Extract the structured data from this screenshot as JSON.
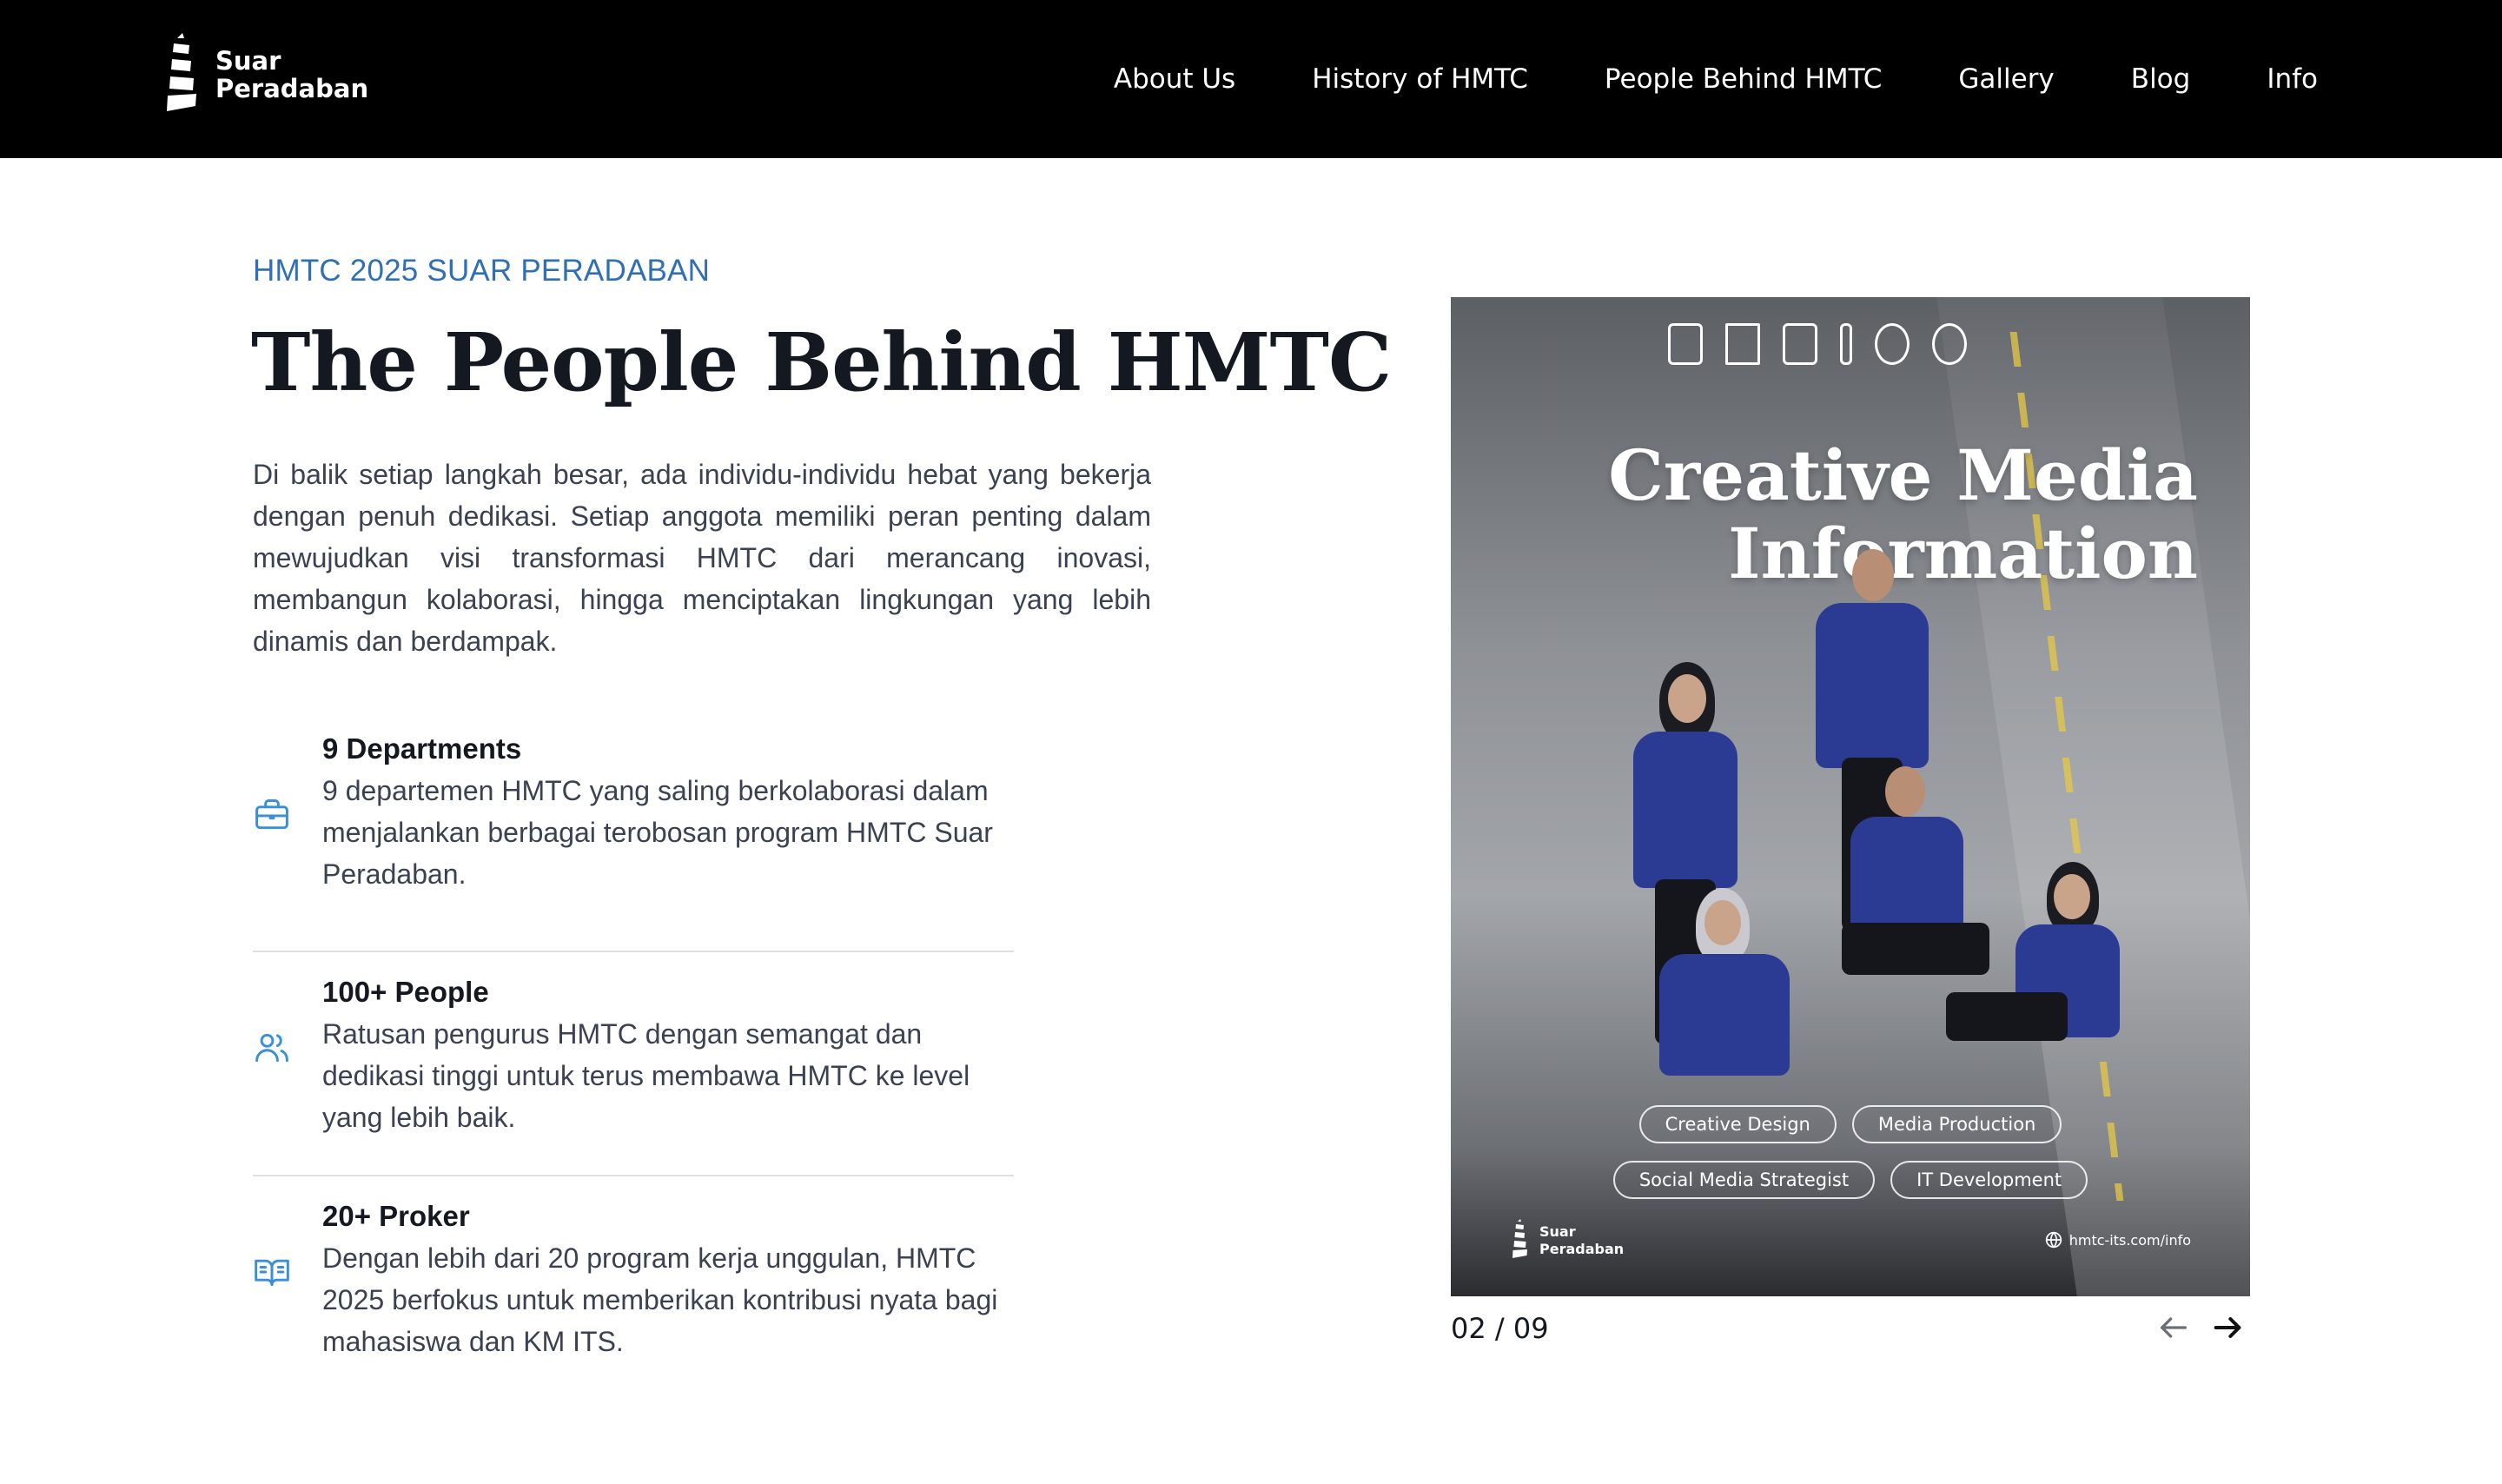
{
  "brand": {
    "line1": "Suar",
    "line2": "Peradaban"
  },
  "nav": {
    "links": [
      "About Us",
      "History of HMTC",
      "People Behind HMTC",
      "Gallery",
      "Blog",
      "Info"
    ]
  },
  "hero": {
    "eyebrow": "HMTC 2025 SUAR PERADABAN",
    "title": "The People Behind HMTC",
    "intro": "Di balik setiap langkah besar, ada individu-individu hebat yang bekerja dengan penuh dedikasi. Setiap anggota memiliki peran penting dalam mewujudkan visi transformasi HMTC dari merancang inovasi, membangun kolaborasi, hingga menciptakan lingkungan yang lebih dinamis dan berdampak."
  },
  "features": [
    {
      "icon": "briefcase-icon",
      "title": "9 Departments",
      "text": "9 departemen HMTC yang saling berkolaborasi dalam menjalankan berbagai terobosan program HMTC Suar Peradaban."
    },
    {
      "icon": "users-icon",
      "title": "100+ People",
      "text": "Ratusan pengurus HMTC dengan semangat dan dedikasi tinggi untuk terus membawa HMTC ke level yang lebih baik."
    },
    {
      "icon": "book-open-icon",
      "title": "20+ Proker",
      "text": "Dengan lebih dari 20 program kerja unggulan, HMTC 2025 berfokus untuk memberikan kontribusi nyata bagi mahasiswa dan KM ITS."
    }
  ],
  "carousel": {
    "slide_title_line1": "Creative Media",
    "slide_title_line2": "Information",
    "tags_row1": [
      "Creative Design",
      "Media Production"
    ],
    "tags_row2": [
      "Social Media Strategist",
      "IT Development"
    ],
    "brand_line1": "Suar",
    "brand_line2": "Peradaban",
    "url": "hmtc-its.com/info",
    "counter": "02 / 09"
  },
  "colors": {
    "accent": "#2f6fb5",
    "nav_bg": "#000000",
    "icon": "#3a8fd6"
  }
}
